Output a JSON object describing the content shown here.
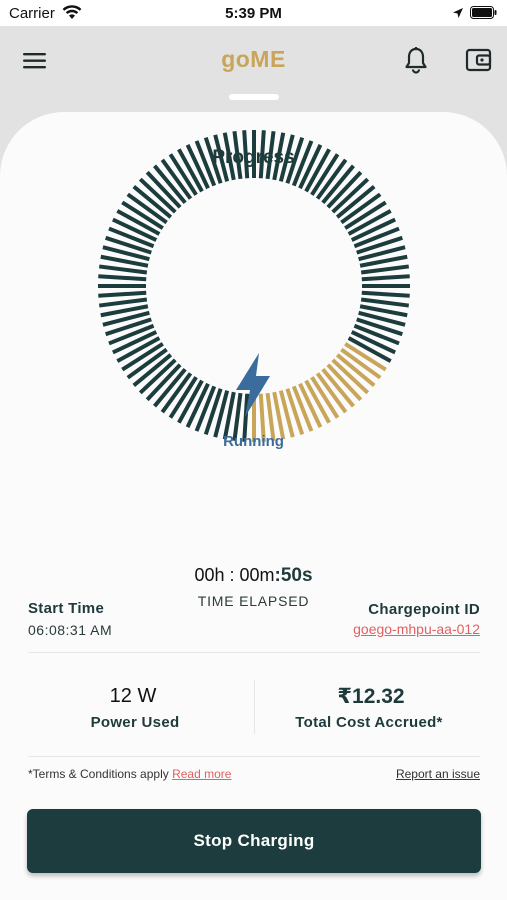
{
  "status_bar": {
    "carrier": "Carrier",
    "time": "5:39 PM"
  },
  "header": {
    "title": "goME"
  },
  "card": {
    "title": "Progress"
  },
  "progress": {
    "status": "Running",
    "fraction": 0.17
  },
  "colors": {
    "track": "#1c3c3d",
    "progress": "#c9a55a",
    "accent": "#e06161"
  },
  "timer": {
    "hm": "00h : 00m",
    "sec": ":50s",
    "label": "TIME ELAPSED"
  },
  "session": {
    "start_label": "Start Time",
    "start_value": "06:08:31 AM",
    "cp_label": "Chargepoint ID",
    "cp_value": "goego-mhpu-aa-012"
  },
  "stats": {
    "power_value": "12 W",
    "power_label": "Power Used",
    "cost_value": "₹12.32",
    "cost_label": "Total Cost Accrued*"
  },
  "footer": {
    "terms": "*Terms & Conditions apply",
    "read_more": "Read more",
    "report": "Report an issue"
  },
  "action": {
    "stop_label": "Stop Charging"
  },
  "icons": [
    "wifi-icon",
    "location-arrow-icon",
    "battery-icon",
    "hamburger-menu-icon",
    "bell-icon",
    "wallet-icon",
    "lightning-bolt-icon"
  ]
}
